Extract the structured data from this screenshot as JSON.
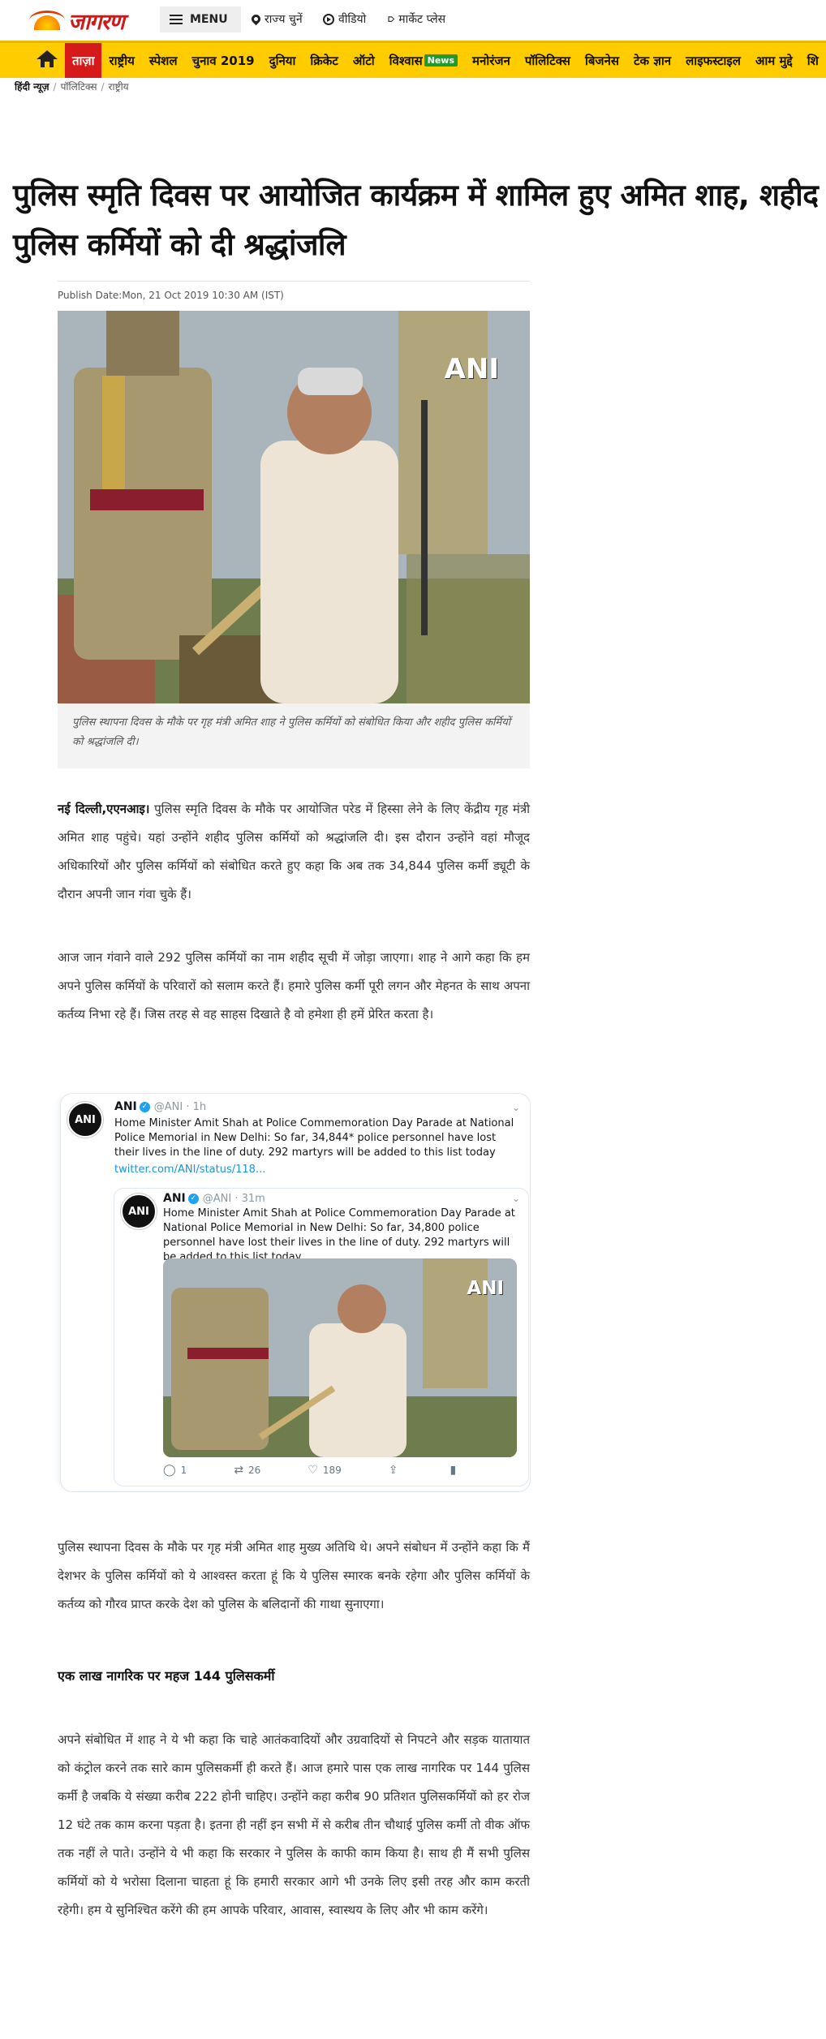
{
  "header": {
    "logo_text": "जागरण",
    "menu_label": "MENU",
    "links": [
      {
        "label": "राज्य चुनें",
        "icon": "location-pin-icon"
      },
      {
        "label": "वीडियो",
        "icon": "play-circle-icon"
      },
      {
        "label": "मार्केट प्लेस",
        "icon": "tag-icon"
      }
    ]
  },
  "nav": {
    "items": [
      {
        "label": "ताज़ा"
      },
      {
        "label": "राष्ट्रीय"
      },
      {
        "label": "स्पेशल"
      },
      {
        "label": "चुनाव 2019"
      },
      {
        "label": "दुनिया"
      },
      {
        "label": "क्रिकेट"
      },
      {
        "label": "ऑटो"
      },
      {
        "label": "विश्वास",
        "badge": "News"
      },
      {
        "label": "मनोरंजन"
      },
      {
        "label": "पॉलिटिक्स"
      },
      {
        "label": "बिजनेस"
      },
      {
        "label": "टेक ज्ञान"
      },
      {
        "label": "लाइफस्टाइल"
      },
      {
        "label": "आम मुद्दे"
      },
      {
        "label": "शि"
      }
    ]
  },
  "breadcrumb": [
    "हिंदी न्यूज़",
    "पॉलिटिक्स",
    "राष्ट्रीय"
  ],
  "article": {
    "headline": "पुलिस स्मृति दिवस पर आयोजित कार्यक्रम में शामिल हुए अमित शाह, शहीद पुलिस कर्मियों को दी श्रद्धांजलि",
    "publish_date": "Publish Date:Mon, 21 Oct 2019 10:30 AM (IST)",
    "image_watermark": "ANI",
    "caption": "पुलिस स्थापना दिवस के मौके पर गृह मंत्री अमित शाह ने पुलिस कर्मियों को संबोधित किया और शहीद पुलिस कर्मियों को श्रद्धांजलि दी।",
    "para1_dateline": "नई दिल्ली,एएनआइ।",
    "para1": " पुलिस स्मृति दिवस के मौके पर आयोजित परेड में हिस्सा लेने के लिए केंद्रीय गृह मंत्री अमित शाह पहुंचे। यहां उन्होंने शहीद पुलिस कर्मियों को श्रद्धांजलि दी। इस दौरान उन्होंने वहां मौजूद अधिकारियों और पुलिस कर्मियों को संबोधित करते हुए कहा कि अब तक 34,844 पुलिस कर्मी ड्यूटी के दौरान अपनी जान गंवा चुके हैं।",
    "para2": "आज जान गंवाने वाले  292 पुलिस कर्मियों का नाम शहीद सूची में जोड़ा जाएगा। शाह ने आगे कहा कि हम अपने पुलिस कर्मियों के परिवारों को सलाम करते हैं। हमारे पुलिस कर्मी पूरी लगन और मेहनत के साथ अपना कर्तव्य निभा रहे हैं। जिस तरह से वह साहस दिखाते है वो हमेशा ही हमें प्रेरित करता है।",
    "para3": "पुलिस स्थापना दिवस के मौके पर गृह मंत्री अमित शाह मुख्य अतिथि थे। अपने संबोधन में उन्होंने कहा कि मैं देशभर के पुलिस कर्मियों को ये आश्वस्त करता हूं कि ये पुलिस स्मारक बनके रहेगा और पुलिस कर्मियों के कर्तव्य को गौरव प्राप्त करके देश को पुलिस के बलिदानों की गाथा सुनाएगा।",
    "subheading": "एक लाख नागरिक पर महज 144 पुलिसकर्मी",
    "para4": "अपने संबोधित में शाह ने ये भी कहा कि चाहे आतंकवादियों और उग्रवादियों से निपटने और सड़क यातायात को कंट्रोल करने तक सारे काम पुलिसकर्मी ही करते हैं। आज हमारे पास एक लाख नागरिक पर 144 पुलिस कर्मी है जबकि ये संख्या करीब 222 होनी चाहिए। उन्होंने कहा करीब 90 प्रतिशत पुलिसकर्मियों को हर रोज 12 घंटे तक काम करना पड़ता है। इतना ही नहीं इन सभी में से करीब तीन चौथाई पुलिस कर्मी तो वीक ऑफ तक नहीं ले पाते। उन्होंने ये भी कहा कि सरकार ने पुलिस के काफी काम किया है। साथ ही मैं सभी पुलिस कर्मियों को ये भरोसा दिलाना चाहता हूं कि हमारी सरकार आगे भी उनके लिए इसी तरह और काम करती रहेगी। हम ये सुनिश्चित करेंगे की हम आपके परिवार, आवास, स्वास्थय के लिए और भी काम करेंगे।"
  },
  "tweet": {
    "name": "ANI",
    "handle": "@ANI · 1h",
    "text": "Home Minister Amit Shah at Police Commemoration Day Parade at National Police Memorial in New Delhi: So far, 34,844* police personnel have lost their lives in the line of duty. 292 martyrs will be added to this list today",
    "link": "twitter.com/ANI/status/118...",
    "avatar_text": "ANI",
    "quoted": {
      "name": "ANI",
      "handle": "@ANI · 31m",
      "text": "Home Minister Amit Shah at Police Commemoration Day Parade at National Police Memorial in New Delhi: So far, 34,800 police personnel have lost their lives in the line of duty. 292 martyrs will be added to this list today",
      "image_watermark": "ANI"
    },
    "actions": {
      "replies": "1",
      "retweets": "26",
      "likes": "189"
    }
  },
  "colors": {
    "nav_bg": "#ffcc00",
    "nav_active": "#d61a1a",
    "logo": "#d01818",
    "twitter_link": "#1b95e0"
  }
}
